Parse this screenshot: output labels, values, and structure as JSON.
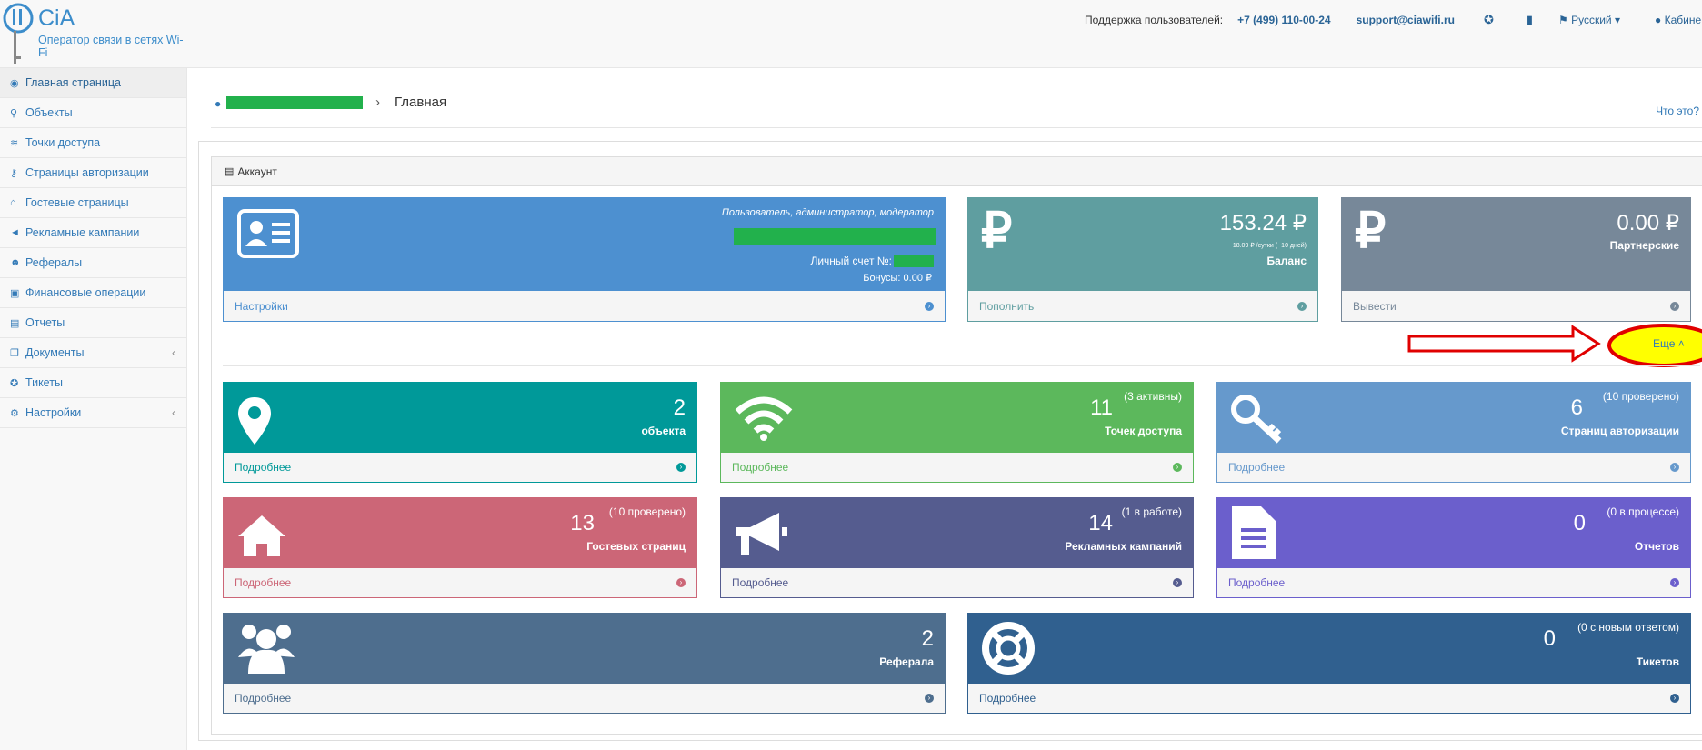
{
  "brand": {
    "name": "CiA",
    "subtitle": "Оператор связи в сетях Wi-Fi"
  },
  "topbar": {
    "support_label": "Поддержка пользователей:",
    "phone": "+7 (499) 110-00-24",
    "email": "support@ciawifi.ru",
    "language": "Русский",
    "cabinet": "Кабине"
  },
  "sidebar": {
    "items": [
      {
        "label": "Главная страница",
        "icon": "dashboard-icon",
        "active": true
      },
      {
        "label": "Объекты",
        "icon": "map-marker-icon"
      },
      {
        "label": "Точки доступа",
        "icon": "wifi-icon"
      },
      {
        "label": "Страницы авторизации",
        "icon": "key-icon"
      },
      {
        "label": "Гостевые страницы",
        "icon": "home-icon"
      },
      {
        "label": "Рекламные кампании",
        "icon": "bullhorn-icon"
      },
      {
        "label": "Рефералы",
        "icon": "users-icon"
      },
      {
        "label": "Финансовые операции",
        "icon": "money-icon"
      },
      {
        "label": "Отчеты",
        "icon": "file-icon"
      },
      {
        "label": "Документы",
        "icon": "copy-icon",
        "has_caret": true
      },
      {
        "label": "Тикеты",
        "icon": "lifebuoy-icon"
      },
      {
        "label": "Настройки",
        "icon": "cogs-icon",
        "has_caret": true
      }
    ]
  },
  "breadcrumb": {
    "current": "Главная",
    "help": "Что это?"
  },
  "panel": {
    "title": "Аккаунт"
  },
  "account": {
    "roles": "Пользователь, администратор, модератор",
    "account_label": "Личный счет №:",
    "bonus": "Бонусы: 0.00 ₽",
    "footer": "Настройки"
  },
  "balance": {
    "value": "153.24 ₽",
    "note": "~18.09 ₽ /сутки (~10 дней)",
    "label": "Баланс",
    "footer": "Пополнить"
  },
  "partner": {
    "value": "0.00 ₽",
    "label": "Партнерские",
    "footer": "Вывести"
  },
  "more": "Еще",
  "tiles": [
    {
      "num": "2",
      "extra": "",
      "label": "объекта",
      "footer": "Подробнее"
    },
    {
      "num": "11",
      "extra": "(3 активны)",
      "label": "Точек доступа",
      "footer": "Подробнее"
    },
    {
      "num": "6",
      "extra": "(10 проверено)",
      "label": "Страниц авторизации",
      "footer": "Подробнее"
    },
    {
      "num": "13",
      "extra": "(10 проверено)",
      "label": "Гостевых страниц",
      "footer": "Подробнее"
    },
    {
      "num": "14",
      "extra": "(1 в работе)",
      "label": "Рекламных кампаний",
      "footer": "Подробнее"
    },
    {
      "num": "0",
      "extra": "(0 в процессе)",
      "label": "Отчетов",
      "footer": "Подробнее"
    },
    {
      "num": "2",
      "extra": "",
      "label": "Реферала",
      "footer": "Подробнее"
    },
    {
      "num": "0",
      "extra": "(0 с новым ответом)",
      "label": "Тикетов",
      "footer": "Подробнее"
    }
  ],
  "colors": {
    "account": "#4d90d0",
    "balance": "#5f9ea0",
    "partner": "#778899",
    "objects": "#009999",
    "wifi": "#5cb85c",
    "auth": "#6699cc",
    "guest": "#cc6677",
    "ads": "#555c8f",
    "reports": "#6b5fcc",
    "refs": "#4e6e8e",
    "tickets": "#30608f"
  }
}
